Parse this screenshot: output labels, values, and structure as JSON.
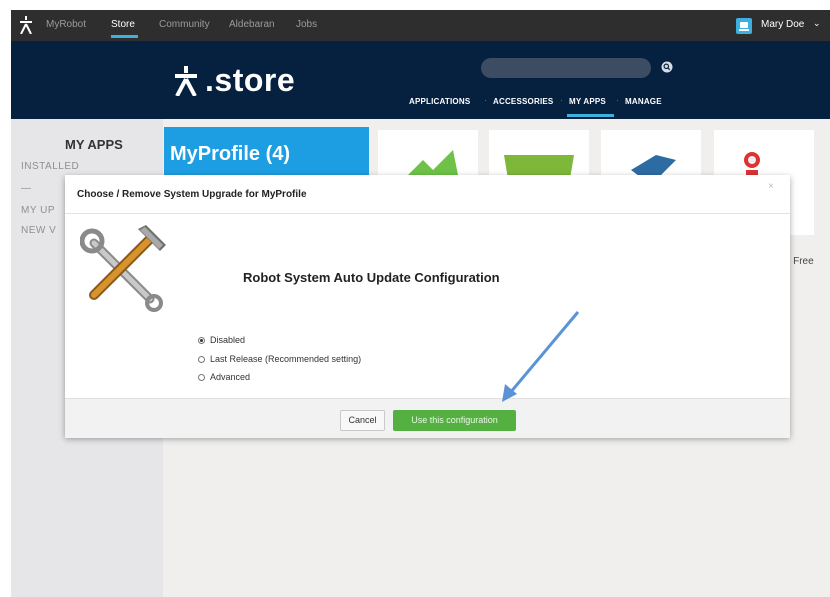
{
  "topnav": {
    "links": [
      "MyRobot",
      "Store",
      "Community",
      "Aldebaran",
      "Jobs"
    ],
    "active": "Store",
    "user": "Mary Doe"
  },
  "store": {
    "logo_text": ".store",
    "nav": [
      "APPLICATIONS",
      "ACCESSORIES",
      "MY APPS",
      "MANAGE"
    ],
    "active_nav": "MY APPS",
    "search_placeholder": ""
  },
  "sidebar": {
    "title": "MY APPS",
    "items": [
      "INSTALLED",
      "—",
      "MY UP",
      "NEW V"
    ]
  },
  "content": {
    "profile_card_title": "MyProfile (4)",
    "free_tag": "- Free"
  },
  "modal": {
    "title": "Choose / Remove System Upgrade for MyProfile",
    "close": "×",
    "heading": "Robot System Auto Update Configuration",
    "options": [
      {
        "label": "Disabled",
        "selected": true
      },
      {
        "label": "Last Release (Recommended setting)",
        "selected": false
      },
      {
        "label": "Advanced",
        "selected": false
      }
    ],
    "cancel_label": "Cancel",
    "confirm_label": "Use this configuration"
  },
  "colors": {
    "accent": "#3db0e0",
    "header_bg": "#05213f",
    "confirm_button": "#55b042",
    "annotation_arrow": "#5b93d6"
  }
}
